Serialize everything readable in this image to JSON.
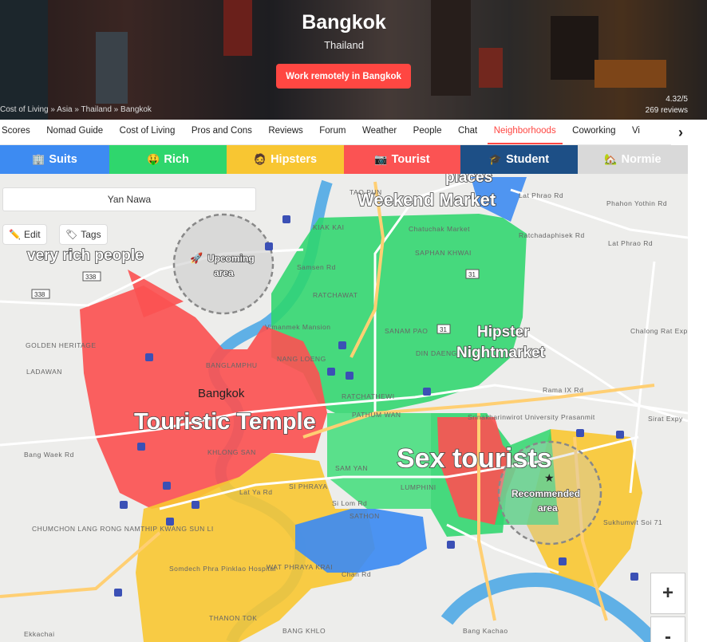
{
  "hero": {
    "city": "Bangkok",
    "country": "Thailand",
    "cta_label": "Work remotely in Bangkok",
    "breadcrumbs": "Cost of Living » Asia » Thailand » Bangkok",
    "rating": "4.32/5",
    "reviews": "269 reviews"
  },
  "tabs": [
    "Scores",
    "Nomad Guide",
    "Cost of Living",
    "Pros and Cons",
    "Reviews",
    "Forum",
    "Weather",
    "People",
    "Chat",
    "Neighborhoods",
    "Coworking",
    "Vi"
  ],
  "active_tab": "Neighborhoods",
  "filters": [
    {
      "icon": "🏢",
      "label": "Suits",
      "color": "#3d8bf2"
    },
    {
      "icon": "🤑",
      "label": "Rich",
      "color": "#2fd66d"
    },
    {
      "icon": "🧔",
      "label": "Hipsters",
      "color": "#f8c632"
    },
    {
      "icon": "📷",
      "label": "Tourist",
      "color": "#fb5353"
    },
    {
      "icon": "🎓",
      "label": "Student",
      "color": "#1d4f86"
    },
    {
      "icon": "🏡",
      "label": "Normie",
      "color": "#d9d9d9"
    }
  ],
  "map": {
    "search_value": "Yan Nawa",
    "edit_label": "Edit",
    "tags_label": "Tags",
    "zoom_in": "+",
    "zoom_out": "-",
    "big_labels": [
      "places",
      "Weekend Market",
      "very rich people",
      "Hipster",
      "Nightmarket",
      "Touristic Temple",
      "Sex tourists"
    ],
    "circle_upcoming": [
      "Upcoming",
      "area"
    ],
    "circle_recommended": [
      "Recommended",
      "area"
    ],
    "city_label": "Bangkok",
    "district_labels": [
      "TAO PUN",
      "KIAK KAI",
      "Chatuchak Market",
      "SAPHAN KHWAI",
      "RATCHAWAT",
      "Vimanmek Mansion",
      "SANAM PAO",
      "DIN DAENG",
      "BANGLAMPHU",
      "NANG LOENG",
      "RATCHATHEWI",
      "PATHUM WAN",
      "GOLDEN HERITAGE",
      "LADAWAN",
      "KHLONG SAN",
      "SAM YAN",
      "SI PHRAYA",
      "Si Lom Rd",
      "SATHON",
      "LUMPHINI",
      "Srinakharinwirot University Prasanmit",
      "CHUMCHON LANG RONG NAMTHIP KWANG SUN LI",
      "Somdech Phra Pinklao Hospital",
      "WAT PHRAYA KRAI",
      "THANON TOK",
      "BANG KHLO",
      "Bang Kachao",
      "Lat Phrao Rd",
      "Ratchadaphisek Rd",
      "Lat Phrao Rd",
      "Chalong Rat Expy",
      "Rama IX Rd",
      "Sirat Expy",
      "Sukhumvit Soi 71",
      "Bang Waek Rd",
      "Lat Ya Rd",
      "Chan Rd",
      "Samsen Rd",
      "Phahon Yothin Rd",
      "Ekkachai"
    ],
    "route_shields": [
      "338",
      "338",
      "31",
      "31"
    ]
  }
}
